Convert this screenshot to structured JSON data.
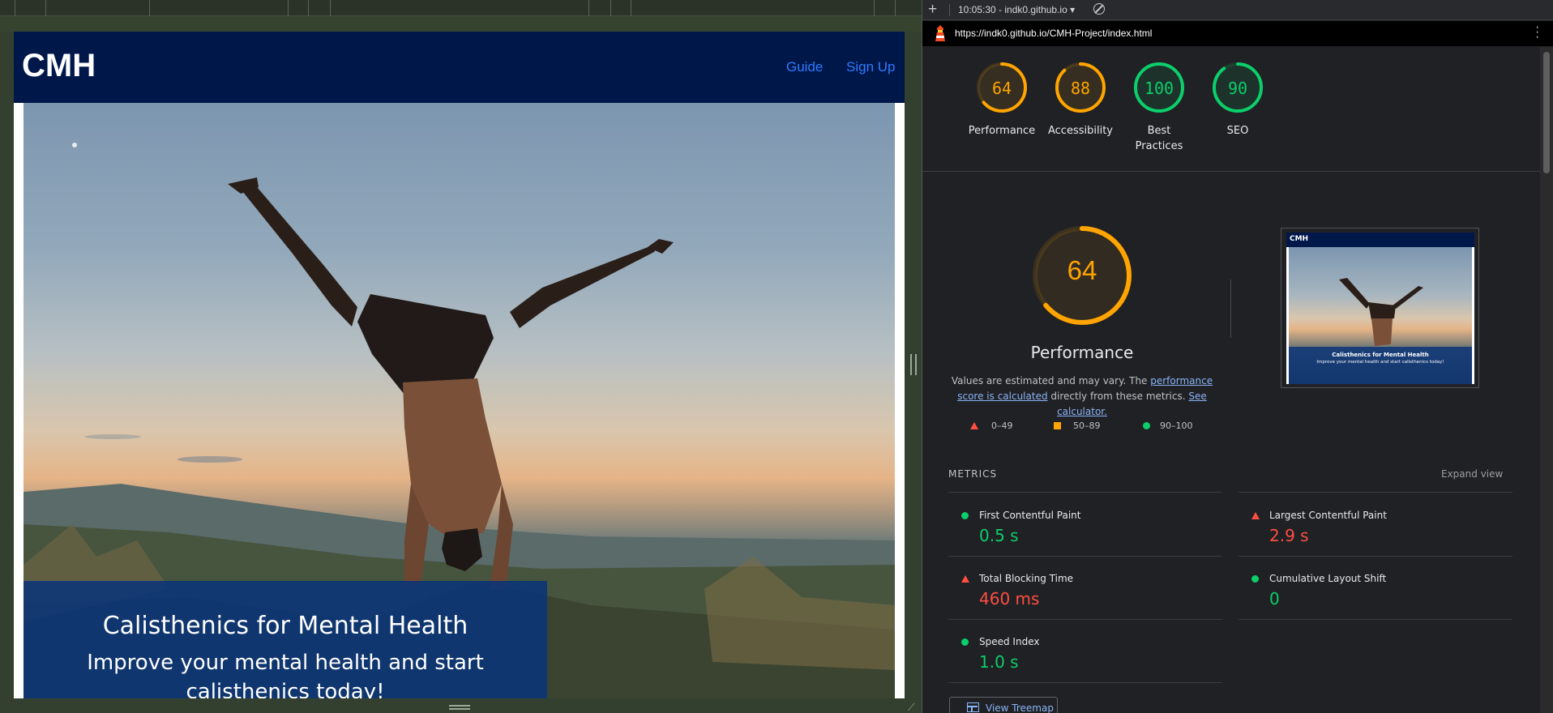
{
  "site": {
    "logo": "CMH",
    "nav": [
      {
        "label": "Guide"
      },
      {
        "label": "Sign Up"
      }
    ],
    "hero": {
      "title": "Calisthenics for Mental Health",
      "subtitle": "Improve your mental health and start calisthenics today!"
    }
  },
  "devtools": {
    "report_select": "10:05:30 - indk0.github.io ▾",
    "url": "https://indk0.github.io/CMH-Project/index.html",
    "gauges": [
      {
        "label": "Performance",
        "score": 64,
        "color": "#ffa400"
      },
      {
        "label": "Accessibility",
        "score": 88,
        "color": "#ffa400"
      },
      {
        "label": "Best Practices",
        "score": 100,
        "color": "#0cce6b"
      },
      {
        "label": "SEO",
        "score": 90,
        "color": "#0cce6b"
      }
    ],
    "performance": {
      "score": "64",
      "title": "Performance",
      "desc_prefix": "Values are estimated and may vary. The ",
      "desc_link1": "performance score is calculated",
      "desc_mid": " directly from these metrics. ",
      "desc_link2": "See calculator."
    },
    "legend": {
      "fail": "0–49",
      "average": "50–89",
      "pass": "90–100"
    },
    "thumbnail": {
      "logo": "CMH",
      "title": "Calisthenics for Mental Health",
      "subtitle": "Improve your mental health and start calisthenics today!"
    },
    "metrics_header": "METRICS",
    "expand_view": "Expand view",
    "metrics": [
      {
        "name": "First Contentful Paint",
        "value": "0.5 s",
        "status": "pass"
      },
      {
        "name": "Largest Contentful Paint",
        "value": "2.9 s",
        "status": "fail"
      },
      {
        "name": "Total Blocking Time",
        "value": "460 ms",
        "status": "fail"
      },
      {
        "name": "Cumulative Layout Shift",
        "value": "0",
        "status": "pass"
      },
      {
        "name": "Speed Index",
        "value": "1.0 s",
        "status": "pass"
      }
    ],
    "treemap_button": "View Treemap"
  }
}
